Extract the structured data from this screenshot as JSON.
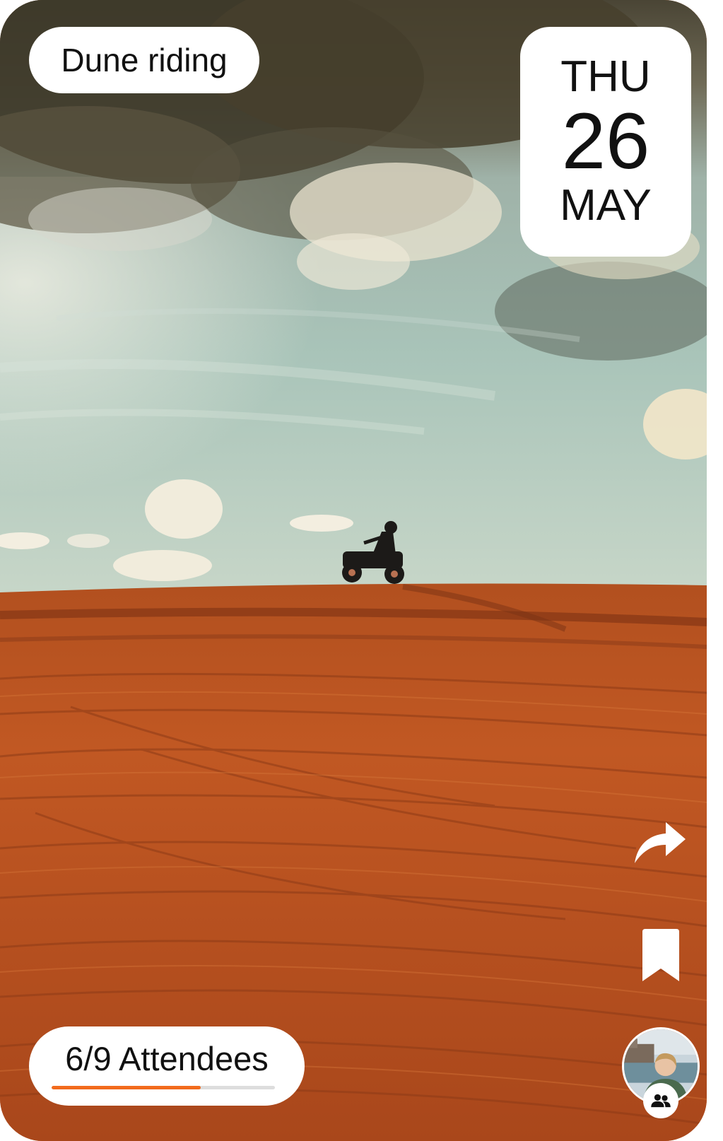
{
  "event": {
    "title": "Dune riding"
  },
  "date": {
    "weekday": "THU",
    "day": "26",
    "month": "MAY"
  },
  "attendees": {
    "label": "6/9 Attendees",
    "current": 6,
    "capacity": 9
  },
  "actions": {
    "share_icon": "share-arrow-icon",
    "bookmark_icon": "bookmark-icon",
    "group_icon": "people-group-icon"
  },
  "colors": {
    "accent": "#f26b1d",
    "sand": "#c65a23",
    "sky": "#a7c1b4"
  }
}
